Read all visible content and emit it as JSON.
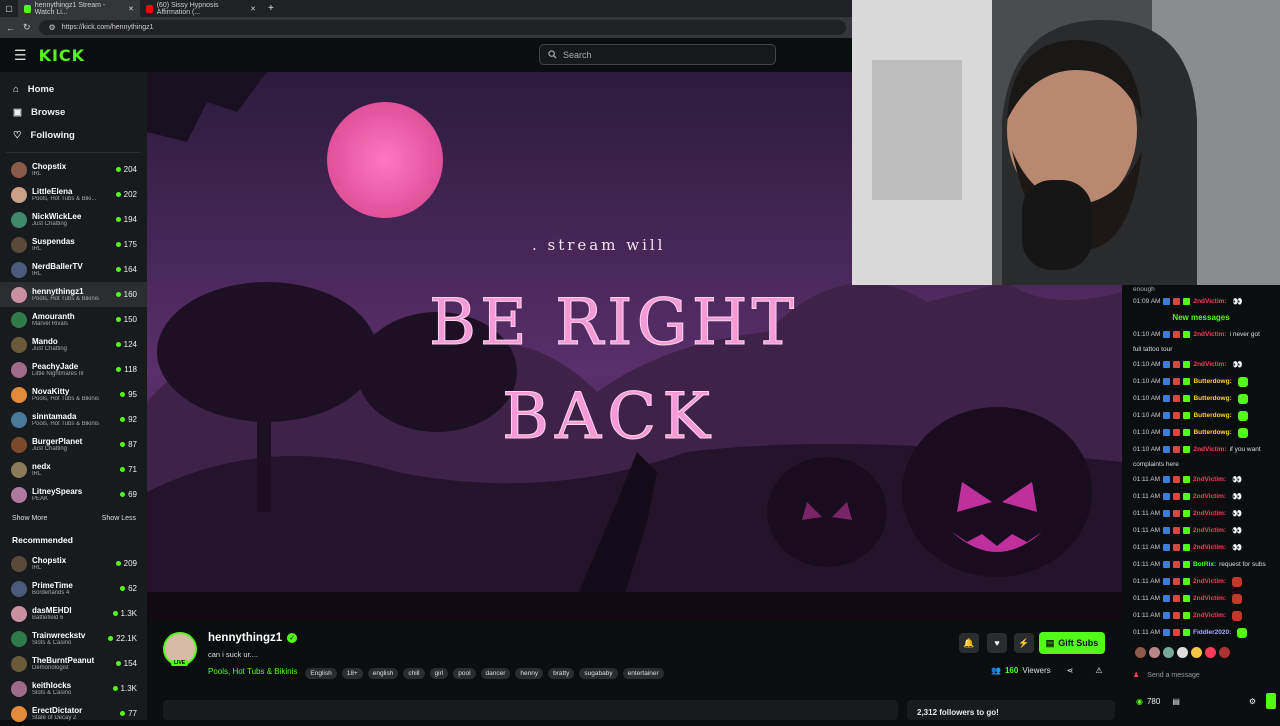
{
  "browser": {
    "tabs": [
      {
        "title": "hennythingz1 Stream - Watch Li..."
      },
      {
        "title": "(60) Sissy Hypnosis Affirmation (..."
      }
    ],
    "url": "https://kick.com/hennythingz1"
  },
  "header": {
    "logo": "KICK",
    "search_placeholder": "Search"
  },
  "sidebar": {
    "nav": [
      {
        "label": "Home",
        "icon": "home-icon"
      },
      {
        "label": "Browse",
        "icon": "browse-icon"
      },
      {
        "label": "Following",
        "icon": "heart-icon"
      }
    ],
    "following": [
      {
        "name": "Chopstix",
        "category": "IRL",
        "viewers": "204"
      },
      {
        "name": "LittleElena",
        "category": "Pools, Hot Tubs & Biki...",
        "viewers": "202"
      },
      {
        "name": "NickWickLee",
        "category": "Just Chatting",
        "viewers": "194"
      },
      {
        "name": "Suspendas",
        "category": "IRL",
        "viewers": "175"
      },
      {
        "name": "NerdBallerTV",
        "category": "IRL",
        "viewers": "164"
      },
      {
        "name": "hennythingz1",
        "category": "Pools, Hot Tubs & Bikinis",
        "viewers": "160"
      },
      {
        "name": "Amouranth",
        "category": "Marvel Rivals",
        "viewers": "150"
      },
      {
        "name": "Mando",
        "category": "Just Chatting",
        "viewers": "124"
      },
      {
        "name": "PeachyJade",
        "category": "Little Nightmares III",
        "viewers": "118"
      },
      {
        "name": "NovaKitty",
        "category": "Pools, Hot Tubs & Bikinis",
        "viewers": "95"
      },
      {
        "name": "sinntamada",
        "category": "Pools, Hot Tubs & Bikinis",
        "viewers": "92"
      },
      {
        "name": "BurgerPlanet",
        "category": "Just Chatting",
        "viewers": "87"
      },
      {
        "name": "nedx",
        "category": "IRL",
        "viewers": "71"
      },
      {
        "name": "LitneySpears",
        "category": "PEAK",
        "viewers": "69"
      }
    ],
    "show_more": "Show More",
    "show_less": "Show Less",
    "recommended_title": "Recommended",
    "recommended": [
      {
        "name": "Chopstix",
        "category": "IRL",
        "viewers": "209"
      },
      {
        "name": "PrimeTime",
        "category": "Borderlands 4",
        "viewers": "62"
      },
      {
        "name": "dasMEHDI",
        "category": "Battlefield 6",
        "viewers": "1.3K"
      },
      {
        "name": "Trainwreckstv",
        "category": "Slots & Casino",
        "viewers": "22.1K"
      },
      {
        "name": "TheBurntPeanut",
        "category": "Demonologist",
        "viewers": "154"
      },
      {
        "name": "keithlocks",
        "category": "Slots & Casino",
        "viewers": "1.3K"
      },
      {
        "name": "ErectDictator",
        "category": "State of Decay 2",
        "viewers": "77"
      }
    ]
  },
  "video": {
    "overlay_small": ". stream will",
    "overlay_line1": "BE RIGHT",
    "overlay_line2": "BACK"
  },
  "streamer": {
    "name": "hennythingz1",
    "title": "can i suck ur....",
    "category": "Pools, Hot Tubs & Bikinis",
    "live_badge": "LIVE",
    "tags": [
      "English",
      "18+",
      "english",
      "chill",
      "girl",
      "pool",
      "dancer",
      "henny",
      "bratty",
      "sugababy",
      "entertainer"
    ],
    "viewers_count": "160",
    "viewers_label": "Viewers",
    "gift_label": "Gift Subs",
    "followers_goal": "2,312 followers to go!"
  },
  "chat": {
    "top_partial": "enough",
    "new_messages_label": "New messages",
    "messages": [
      {
        "time": "01:09 AM",
        "user": "2ndVictim",
        "user_color": "#ff3b5c",
        "text": "",
        "emote": "eyes"
      },
      {
        "time": "01:10 AM",
        "user": "2ndVictim",
        "user_color": "#ff3b5c",
        "text": "i never got",
        "cont": "full tattoo tour"
      },
      {
        "time": "01:10 AM",
        "user": "2ndVictim",
        "user_color": "#ff3b5c",
        "text": "",
        "emote": "eyes"
      },
      {
        "time": "01:10 AM",
        "user": "Butterdowg",
        "user_color": "#ffd21e",
        "text": "",
        "emote": "green"
      },
      {
        "time": "01:10 AM",
        "user": "Butterdowg",
        "user_color": "#ffd21e",
        "text": "",
        "emote": "green"
      },
      {
        "time": "01:10 AM",
        "user": "Butterdowg",
        "user_color": "#ffd21e",
        "text": "",
        "emote": "green"
      },
      {
        "time": "01:10 AM",
        "user": "Butterdowg",
        "user_color": "#ffd21e",
        "text": "",
        "emote": "green"
      },
      {
        "time": "01:10 AM",
        "user": "2ndVictim",
        "user_color": "#ff3b5c",
        "text": "if you want",
        "cont": "complaints here"
      },
      {
        "time": "01:11 AM",
        "user": "2ndVictim",
        "user_color": "#ff3b5c",
        "text": "",
        "emote": "eyes"
      },
      {
        "time": "01:11 AM",
        "user": "2ndVictim",
        "user_color": "#ff3b5c",
        "text": "",
        "emote": "eyes"
      },
      {
        "time": "01:11 AM",
        "user": "2ndVictim",
        "user_color": "#ff3b5c",
        "text": "",
        "emote": "eyes"
      },
      {
        "time": "01:11 AM",
        "user": "2ndVictim",
        "user_color": "#ff3b5c",
        "text": "",
        "emote": "eyes"
      },
      {
        "time": "01:11 AM",
        "user": "2ndVictim",
        "user_color": "#ff3b5c",
        "text": "",
        "emote": "eyes"
      },
      {
        "time": "01:11 AM",
        "user": "BotRix",
        "user_color": "#53fc18",
        "text": "request for subs"
      },
      {
        "time": "01:11 AM",
        "user": "2ndVictim",
        "user_color": "#ff3b5c",
        "text": "",
        "emote": "red"
      },
      {
        "time": "01:11 AM",
        "user": "2ndVictim",
        "user_color": "#ff3b5c",
        "text": "",
        "emote": "red"
      },
      {
        "time": "01:11 AM",
        "user": "2ndVictim",
        "user_color": "#ff3b5c",
        "text": "",
        "emote": "red"
      },
      {
        "time": "01:11 AM",
        "user": "Fiddler2020",
        "user_color": "#a9a9ff",
        "text": "",
        "emote": "green"
      }
    ],
    "input_placeholder": "Send a message",
    "points": "780"
  }
}
